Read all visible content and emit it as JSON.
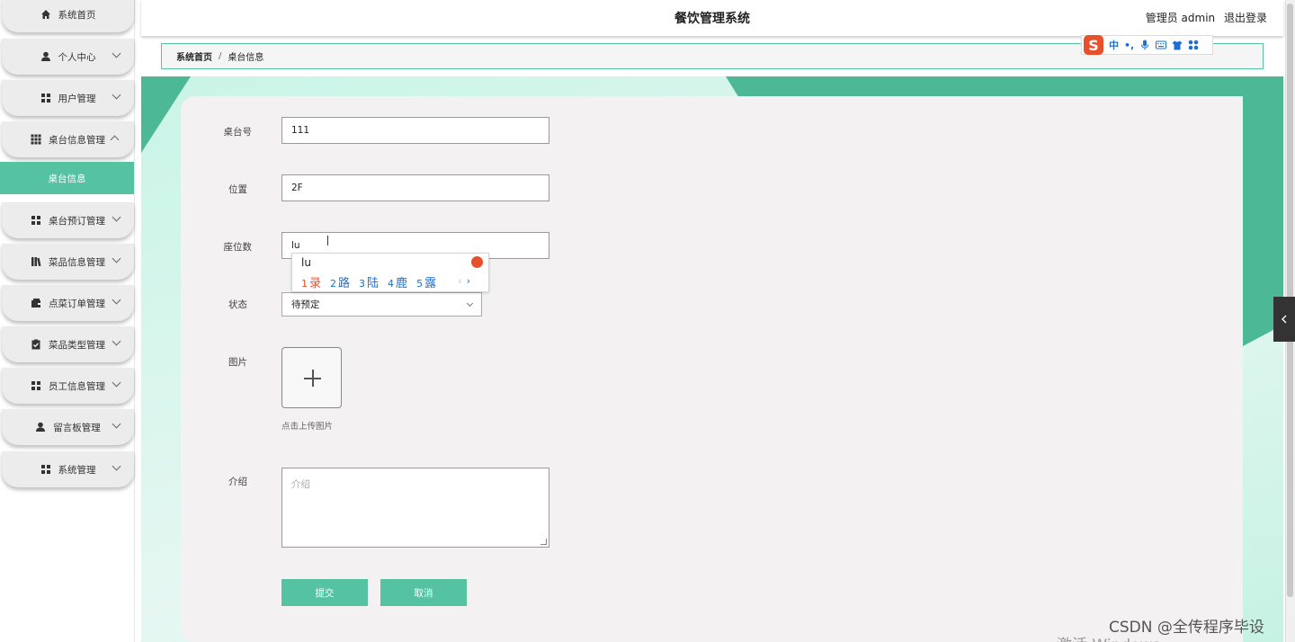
{
  "app": {
    "title": "餐饮管理系统",
    "user_label": "管理员 admin",
    "logout_label": "退出登录"
  },
  "sidebar": {
    "items": [
      {
        "label": "系统首页",
        "icon": "home-icon",
        "expanded": false,
        "has_chevron": false
      },
      {
        "label": "个人中心",
        "icon": "user-icon",
        "expanded": false,
        "has_chevron": true
      },
      {
        "label": "用户管理",
        "icon": "grid-icon",
        "expanded": false,
        "has_chevron": true
      },
      {
        "label": "桌台信息管理",
        "icon": "grid9-icon",
        "expanded": true,
        "has_chevron": true
      },
      {
        "label": "桌台预订管理",
        "icon": "grid-icon",
        "expanded": false,
        "has_chevron": true
      },
      {
        "label": "菜品信息管理",
        "icon": "books-icon",
        "expanded": false,
        "has_chevron": true
      },
      {
        "label": "点菜订单管理",
        "icon": "wallet-icon",
        "expanded": false,
        "has_chevron": true
      },
      {
        "label": "菜品类型管理",
        "icon": "clipboard-icon",
        "expanded": false,
        "has_chevron": true
      },
      {
        "label": "员工信息管理",
        "icon": "grid-icon",
        "expanded": false,
        "has_chevron": true
      },
      {
        "label": "留言板管理",
        "icon": "user-icon",
        "expanded": false,
        "has_chevron": true
      },
      {
        "label": "系统管理",
        "icon": "grid-icon",
        "expanded": false,
        "has_chevron": true
      }
    ],
    "active_sub": "桌台信息"
  },
  "breadcrumb": {
    "home": "系统首页",
    "separator": "/",
    "current": "桌台信息"
  },
  "ime": {
    "logo": "S",
    "mode": "中",
    "punct": "•,",
    "popup_pinyin": "lu",
    "candidates": [
      {
        "n": "1",
        "c": "录"
      },
      {
        "n": "2",
        "c": "路"
      },
      {
        "n": "3",
        "c": "陆"
      },
      {
        "n": "4",
        "c": "鹿"
      },
      {
        "n": "5",
        "c": "露"
      }
    ],
    "pager_prev": "‹",
    "pager_next": "›"
  },
  "form": {
    "table_no": {
      "label": "桌台号",
      "value": "111"
    },
    "location": {
      "label": "位置",
      "value": "2F"
    },
    "seats": {
      "label": "座位数",
      "value": "lu"
    },
    "status": {
      "label": "状态",
      "value": "待预定"
    },
    "image": {
      "label": "图片",
      "hint": "点击上传图片"
    },
    "intro": {
      "label": "介绍",
      "placeholder": "介绍"
    }
  },
  "buttons": {
    "submit": "提交",
    "cancel": "取消"
  },
  "watermark": {
    "csdn": "CSDN @全传程序毕设",
    "windows": "激活 Windows"
  },
  "colors": {
    "accent": "#55c2a1",
    "accent_dark": "#4db896",
    "ime_red": "#e6502b",
    "ime_blue": "#1f6fd0"
  }
}
